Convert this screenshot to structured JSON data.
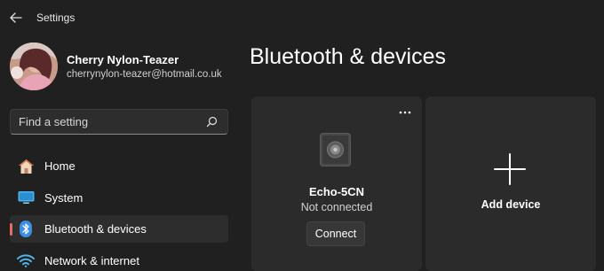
{
  "app": {
    "title": "Settings"
  },
  "profile": {
    "name": "Cherry Nylon-Teazer",
    "email": "cherrynylon-teazer@hotmail.co.uk"
  },
  "search": {
    "placeholder": "Find a setting",
    "value": ""
  },
  "nav": {
    "items": [
      {
        "label": "Home",
        "icon": "home-icon"
      },
      {
        "label": "System",
        "icon": "system-icon"
      },
      {
        "label": "Bluetooth & devices",
        "icon": "bluetooth-icon",
        "selected": true
      },
      {
        "label": "Network & internet",
        "icon": "wifi-icon"
      }
    ]
  },
  "main": {
    "title": "Bluetooth & devices",
    "device": {
      "name": "Echo-5CN",
      "status": "Not connected",
      "action_label": "Connect",
      "icon": "speaker-icon"
    },
    "add_device": {
      "label": "Add device",
      "icon": "plus-icon"
    }
  },
  "colors": {
    "background": "#202020",
    "card": "#2b2b2b",
    "accent_indicator": "#e56e64",
    "bluetooth_blue": "#3a8ee6"
  }
}
